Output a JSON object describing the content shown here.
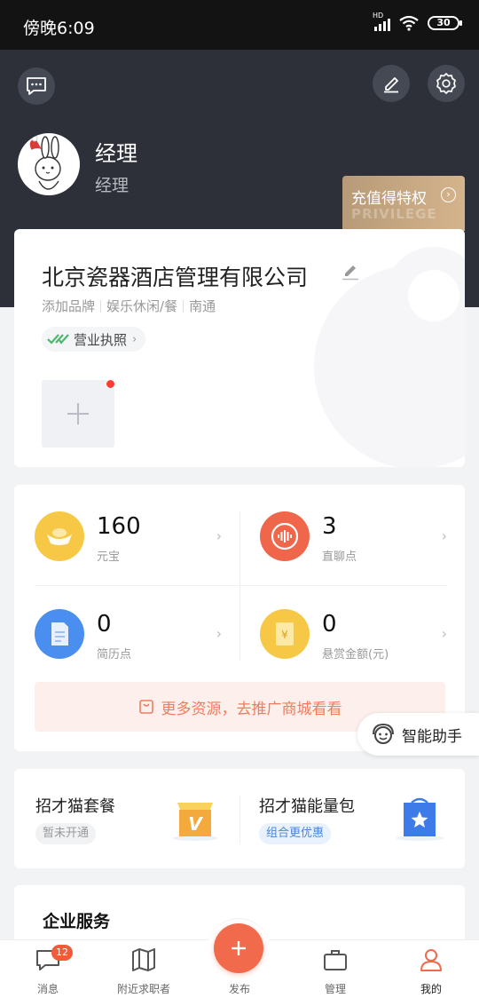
{
  "status_bar": {
    "time": "傍晚6:09",
    "network": "HD",
    "battery": "30"
  },
  "user": {
    "name": "经理",
    "role": "经理"
  },
  "privilege": {
    "label": "充值得特权",
    "watermark": "PRIVILEGE"
  },
  "company": {
    "name": "北京瓷器酒店管理有限公司",
    "meta": [
      "添加品牌",
      "娱乐休闲/餐",
      "南通"
    ],
    "license": "营业执照"
  },
  "stats": [
    {
      "value": "160",
      "label": "元宝"
    },
    {
      "value": "3",
      "label": "直聊点"
    },
    {
      "value": "0",
      "label": "简历点"
    },
    {
      "value": "0",
      "label": "悬赏金额(元)"
    }
  ],
  "promo": {
    "text": "更多资源，去推广商城看看"
  },
  "assistant": {
    "label": "智能助手"
  },
  "packages": [
    {
      "title": "招才猫套餐",
      "tag": "暂未开通"
    },
    {
      "title": "招才猫能量包",
      "tag": "组合更优惠"
    }
  ],
  "services": {
    "title": "企业服务"
  },
  "tabs": {
    "messages": {
      "label": "消息",
      "badge": "12"
    },
    "nearby": {
      "label": "附近求职者"
    },
    "publish": {
      "label": "发布"
    },
    "manage": {
      "label": "管理"
    },
    "mine": {
      "label": "我的"
    }
  },
  "colors": {
    "accent": "#f16a4b",
    "header_bg": "#2d3038",
    "gold": "#c9a47a"
  }
}
